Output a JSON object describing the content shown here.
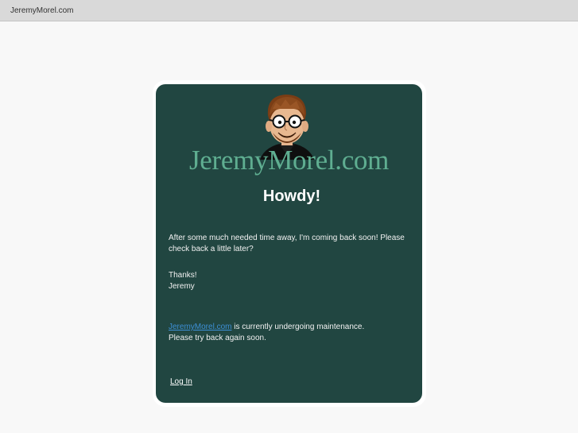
{
  "window": {
    "title": "JeremyMorel.com"
  },
  "card": {
    "logo_text": "JeremyMorel.com",
    "heading": "Howdy!",
    "message_line1": "After some much needed time away, I'm coming back soon! Please",
    "message_line2": "check back a little later?",
    "thanks": "Thanks!",
    "signature": "Jeremy",
    "maintenance_link": "JeremyMorel.com",
    "maintenance_text": " is currently undergoing maintenance.",
    "maintenance_line2": "Please try back again soon.",
    "login_label": "Log In"
  },
  "colors": {
    "card_background": "#214641",
    "logo_text": "#5fae91",
    "link": "#3d8fd6"
  },
  "icons": {
    "avatar": "cartoon-avatar-icon"
  }
}
